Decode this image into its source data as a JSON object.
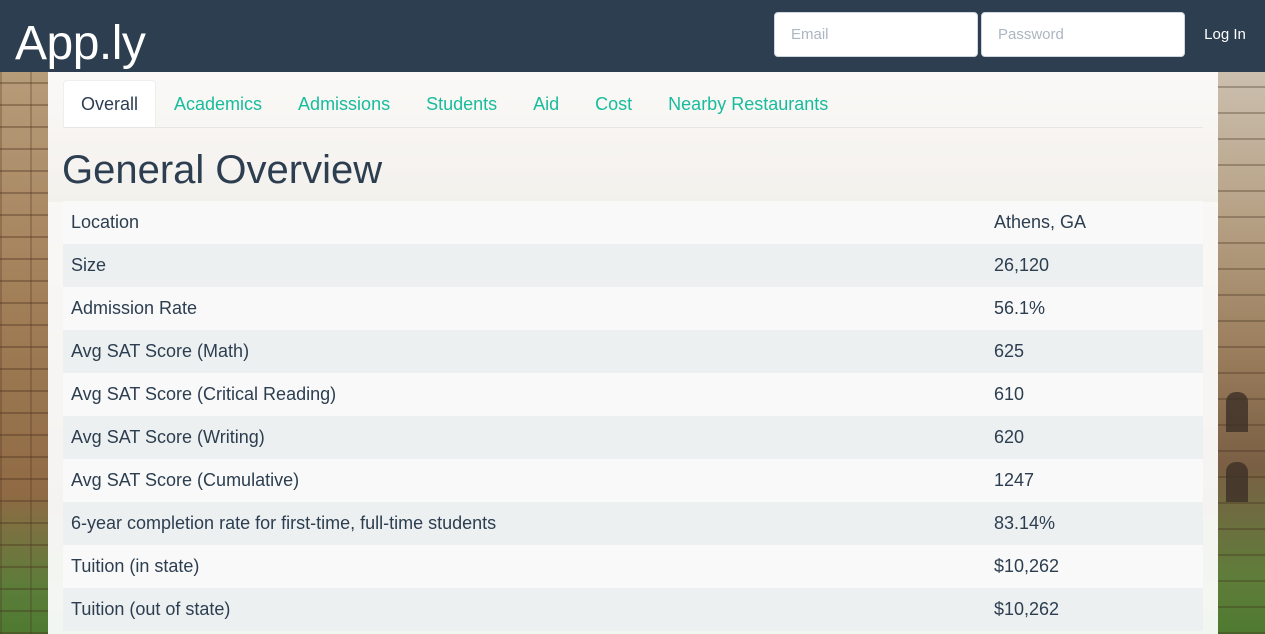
{
  "navbar": {
    "brand": "App.ly",
    "email_placeholder": "Email",
    "password_placeholder": "Password",
    "login_label": "Log In"
  },
  "tabs": [
    {
      "label": "Overall",
      "active": true
    },
    {
      "label": "Academics",
      "active": false
    },
    {
      "label": "Admissions",
      "active": false
    },
    {
      "label": "Students",
      "active": false
    },
    {
      "label": "Aid",
      "active": false
    },
    {
      "label": "Cost",
      "active": false
    },
    {
      "label": "Nearby Restaurants",
      "active": false
    }
  ],
  "main": {
    "title": "General Overview",
    "rows": [
      {
        "label": "Location",
        "value": "Athens, GA"
      },
      {
        "label": "Size",
        "value": "26,120"
      },
      {
        "label": "Admission Rate",
        "value": "56.1%"
      },
      {
        "label": "Avg SAT Score (Math)",
        "value": "625"
      },
      {
        "label": "Avg SAT Score (Critical Reading)",
        "value": "610"
      },
      {
        "label": "Avg SAT Score (Writing)",
        "value": "620"
      },
      {
        "label": "Avg SAT Score (Cumulative)",
        "value": "1247"
      },
      {
        "label": "6-year completion rate for first-time, full-time students",
        "value": "83.14%"
      },
      {
        "label": "Tuition (in state)",
        "value": "$10,262"
      },
      {
        "label": "Tuition (out of state)",
        "value": "$10,262"
      }
    ]
  },
  "colors": {
    "navbar_bg": "#2c3e50",
    "tab_link": "#18bc9c",
    "text": "#2c3e50"
  }
}
